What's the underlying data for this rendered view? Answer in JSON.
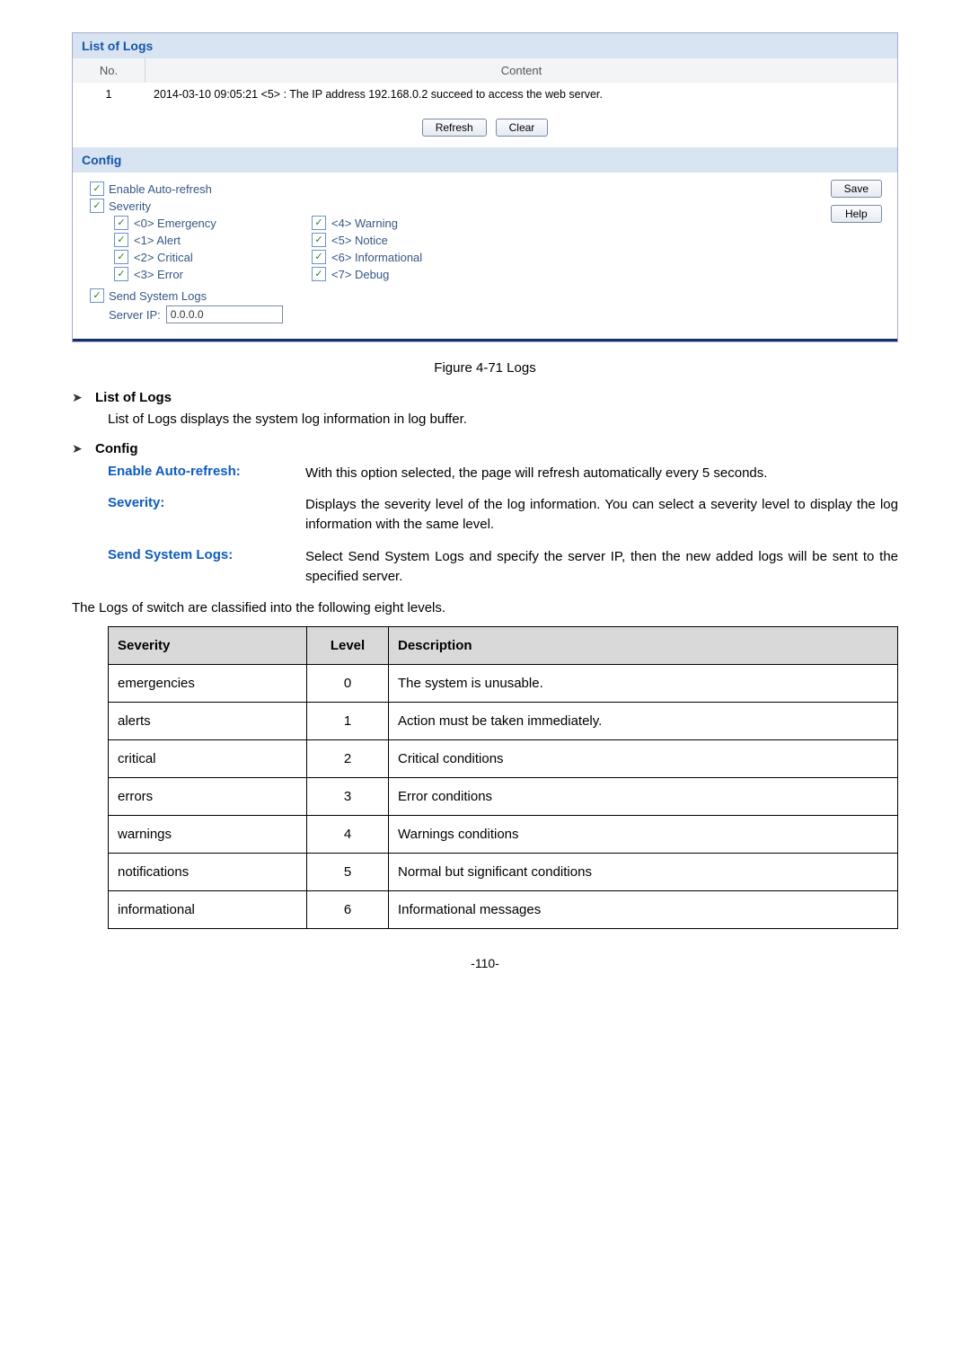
{
  "panel": {
    "title_list": "List of Logs",
    "col_no": "No.",
    "col_content": "Content",
    "row_no": "1",
    "row_content": "2014-03-10 09:05:21 <5> : The IP address 192.168.0.2 succeed to access the web server.",
    "btn_refresh": "Refresh",
    "btn_clear": "Clear",
    "title_config": "Config",
    "enable_auto_refresh": "Enable Auto-refresh",
    "severity": "Severity",
    "btn_save": "Save",
    "btn_help": "Help",
    "sev": {
      "s0": "<0> Emergency",
      "s1": "<1> Alert",
      "s2": "<2> Critical",
      "s3": "<3> Error",
      "s4": "<4> Warning",
      "s5": "<5> Notice",
      "s6": "<6> Informational",
      "s7": "<7> Debug"
    },
    "send_logs": "Send System Logs",
    "server_ip_label": "Server IP:",
    "server_ip_value": "0.0.0.0"
  },
  "caption": "Figure 4-71 Logs",
  "bullets": {
    "b1": "List of Logs",
    "b1_txt": "List of Logs displays the system log information in log buffer.",
    "b2": "Config"
  },
  "defs": {
    "t1": "Enable Auto-refresh:",
    "d1": "With this option selected, the page will refresh automatically every 5 seconds.",
    "t2": "Severity:",
    "d2": "Displays the severity level of the log information. You can select a severity level to display the log information with the same level.",
    "t3": "Send System Logs:",
    "d3": "Select Send System Logs and specify the server IP, then the new added logs will be sent to the specified server."
  },
  "lead_in": "The Logs of switch are classified into the following eight levels.",
  "table": {
    "h1": "Severity",
    "h2": "Level",
    "h3": "Description",
    "rows": [
      {
        "s": "emergencies",
        "l": "0",
        "d": "The system is unusable."
      },
      {
        "s": "alerts",
        "l": "1",
        "d": "Action must be taken immediately."
      },
      {
        "s": "critical",
        "l": "2",
        "d": "Critical conditions"
      },
      {
        "s": "errors",
        "l": "3",
        "d": "Error conditions"
      },
      {
        "s": "warnings",
        "l": "4",
        "d": "Warnings conditions"
      },
      {
        "s": "notifications",
        "l": "5",
        "d": "Normal but significant conditions"
      },
      {
        "s": "informational",
        "l": "6",
        "d": "Informational messages"
      }
    ]
  },
  "pagenum": "-110-",
  "check": "✓"
}
